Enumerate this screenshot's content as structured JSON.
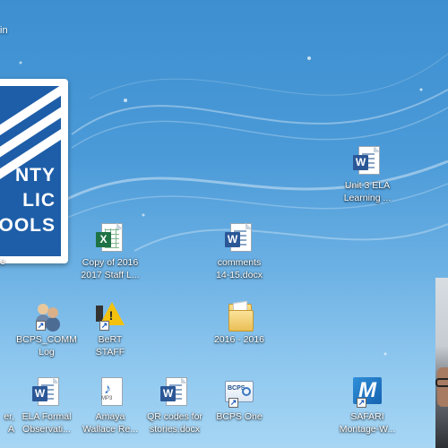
{
  "desktop": {
    "corner_label": "in",
    "logo": {
      "lines": [
        "NTY",
        "LIC",
        "OOLS"
      ],
      "caption": "e"
    },
    "icons": [
      {
        "id": "unit3",
        "label": "Unit 3 ELA\nLearning ...",
        "type": "word"
      },
      {
        "id": "copy2016",
        "label": "Copy of 2016\n2017 Staff L...",
        "type": "excel"
      },
      {
        "id": "comments",
        "label": "comments\n14-15.docx",
        "type": "word"
      },
      {
        "id": "bcpscomm",
        "label": "BCPS_COMM\nLog",
        "type": "people"
      },
      {
        "id": "bert",
        "label": "BeRT\nSTAFF",
        "type": "warning"
      },
      {
        "id": "folder2016",
        "label": "2016 - 2016",
        "type": "folder"
      },
      {
        "id": "partial",
        "label": "er,\nA",
        "type": "word"
      },
      {
        "id": "elaformal",
        "label": "ELA Formal\nObservati...",
        "type": "word"
      },
      {
        "id": "amaya",
        "label": "Amaya\nWallace Re...",
        "type": "mp3"
      },
      {
        "id": "qrcodes",
        "label": "QR codes for\nstories.docx",
        "type": "word"
      },
      {
        "id": "bcpsone",
        "label": "BCPS One",
        "type": "bcps-one"
      },
      {
        "id": "safari",
        "label": "SAFARI\nMontage-W...",
        "type": "safari"
      }
    ],
    "icon_glyphs": {
      "word_letter": "W",
      "excel_letter": "X",
      "warning_mark": "!",
      "mp3_note": "♪",
      "mp3_text": "MP3",
      "bcps_one_text": "BCPS",
      "safari_letter": "M",
      "shortcut_arrow": "↗"
    },
    "colors": {
      "background_top": "#3d8fd0",
      "background_bottom": "#a7d6f4",
      "logo_blue": "#1e5ea8",
      "word_blue": "#2b5797",
      "excel_green": "#1f7244"
    }
  }
}
